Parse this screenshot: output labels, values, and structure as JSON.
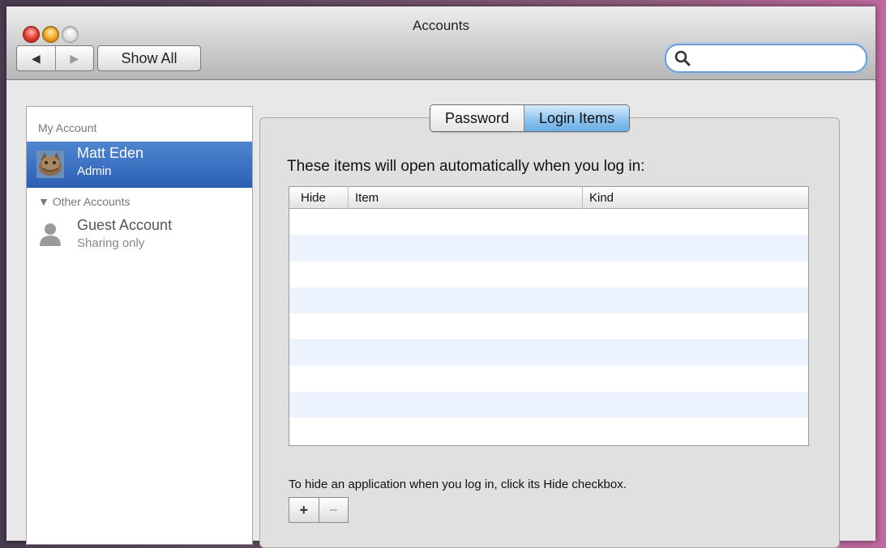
{
  "window": {
    "title": "Accounts"
  },
  "toolbar": {
    "back_icon": "◀",
    "forward_icon": "▶",
    "show_all_label": "Show All",
    "search_value": "",
    "search_icon": "search-icon"
  },
  "sidebar": {
    "my_account_header": "My Account",
    "current_user": {
      "name": "Matt Eden",
      "role": "Admin"
    },
    "other_accounts_header": "▼ Other Accounts",
    "other_accounts": [
      {
        "name": "Guest Account",
        "subtitle": "Sharing only"
      }
    ]
  },
  "tabs": [
    {
      "label": "Password",
      "active": false
    },
    {
      "label": "Login Items",
      "active": true
    }
  ],
  "login_items": {
    "heading": "These items will open automatically when you log in:",
    "columns": [
      "Hide",
      "Item",
      "Kind"
    ],
    "rows": [],
    "hint": "To hide an application when you log in, click its Hide checkbox.",
    "add_label": "+",
    "remove_label": "−"
  },
  "colors": {
    "selection": "#2a5fb3",
    "active_tab": "#8fc3ee",
    "alt_row": "#edf3fe"
  }
}
